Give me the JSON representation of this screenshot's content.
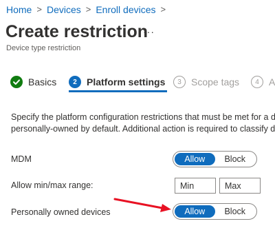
{
  "breadcrumb": {
    "items": [
      "Home",
      "Devices",
      "Enroll devices"
    ],
    "separator": ">"
  },
  "header": {
    "title": "Create restriction",
    "more": "···",
    "subtitle": "Device type restriction"
  },
  "wizard": {
    "steps": [
      {
        "number": "",
        "label": "Basics",
        "state": "completed"
      },
      {
        "number": "2",
        "label": "Platform settings",
        "state": "current"
      },
      {
        "number": "3",
        "label": "Scope tags",
        "state": "upcoming"
      },
      {
        "number": "4",
        "label": "As",
        "state": "upcoming"
      }
    ]
  },
  "main": {
    "description_line1": "Specify the platform configuration restrictions that must be met for a d",
    "description_line2": "personally-owned by default. Additional action is required to classify de",
    "settings": {
      "mdm": {
        "label": "MDM",
        "allow_label": "Allow",
        "block_label": "Block",
        "selected": "Allow"
      },
      "minmax": {
        "label": "Allow min/max range:",
        "min_placeholder": "Min",
        "max_placeholder": "Max"
      },
      "personal": {
        "label": "Personally owned devices",
        "allow_label": "Allow",
        "block_label": "Block",
        "selected": "Allow"
      }
    }
  },
  "annotation": {
    "arrow_color": "#e81123"
  },
  "colors": {
    "accent": "#0f6cbd",
    "success": "#107c10",
    "text": "#323130",
    "muted": "#a19f9d"
  }
}
